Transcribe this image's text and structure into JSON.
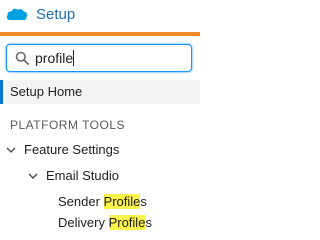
{
  "header": {
    "title": "Setup",
    "logo_icon": "cloud-icon",
    "brand_color": "#00a1e0",
    "accent_color": "#f28c28"
  },
  "search": {
    "value": "profile",
    "icon": "search-icon"
  },
  "nav": {
    "selected_item": "Setup Home",
    "section_heading": "PLATFORM TOOLS",
    "tree": {
      "level1": "Feature Settings",
      "level2": "Email Studio",
      "items": [
        {
          "prefix": "Sender ",
          "match": "Profile",
          "suffix": "s"
        },
        {
          "prefix": "Delivery ",
          "match": "Profile",
          "suffix": "s"
        }
      ]
    },
    "highlight_color": "#fbf34a"
  }
}
